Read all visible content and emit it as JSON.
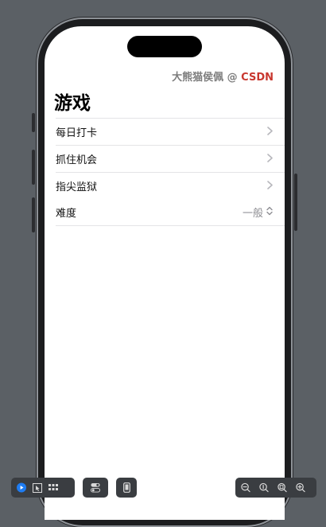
{
  "watermark": {
    "author": "大熊猫侯佩 @ ",
    "brand": "CSDN"
  },
  "page": {
    "title": "游戏"
  },
  "rows": [
    {
      "label": "每日打卡"
    },
    {
      "label": "抓住机会"
    },
    {
      "label": "指尖监狱"
    },
    {
      "label": "难度",
      "value": "一般"
    }
  ],
  "icons": {
    "chevron": "chevron-right-icon",
    "updown": "chevron-up-down-icon",
    "play": "play-circle-icon",
    "select": "cursor-select-icon",
    "grid": "grid-icon",
    "toggle": "toggle-icon",
    "device": "device-icon",
    "zoom_out": "zoom-out-icon",
    "zoom_actual": "zoom-actual-icon",
    "zoom_fit": "zoom-fit-icon",
    "zoom_in": "zoom-in-icon"
  },
  "colors": {
    "brand": "#c8372f",
    "accent": "#1e7cf2"
  }
}
